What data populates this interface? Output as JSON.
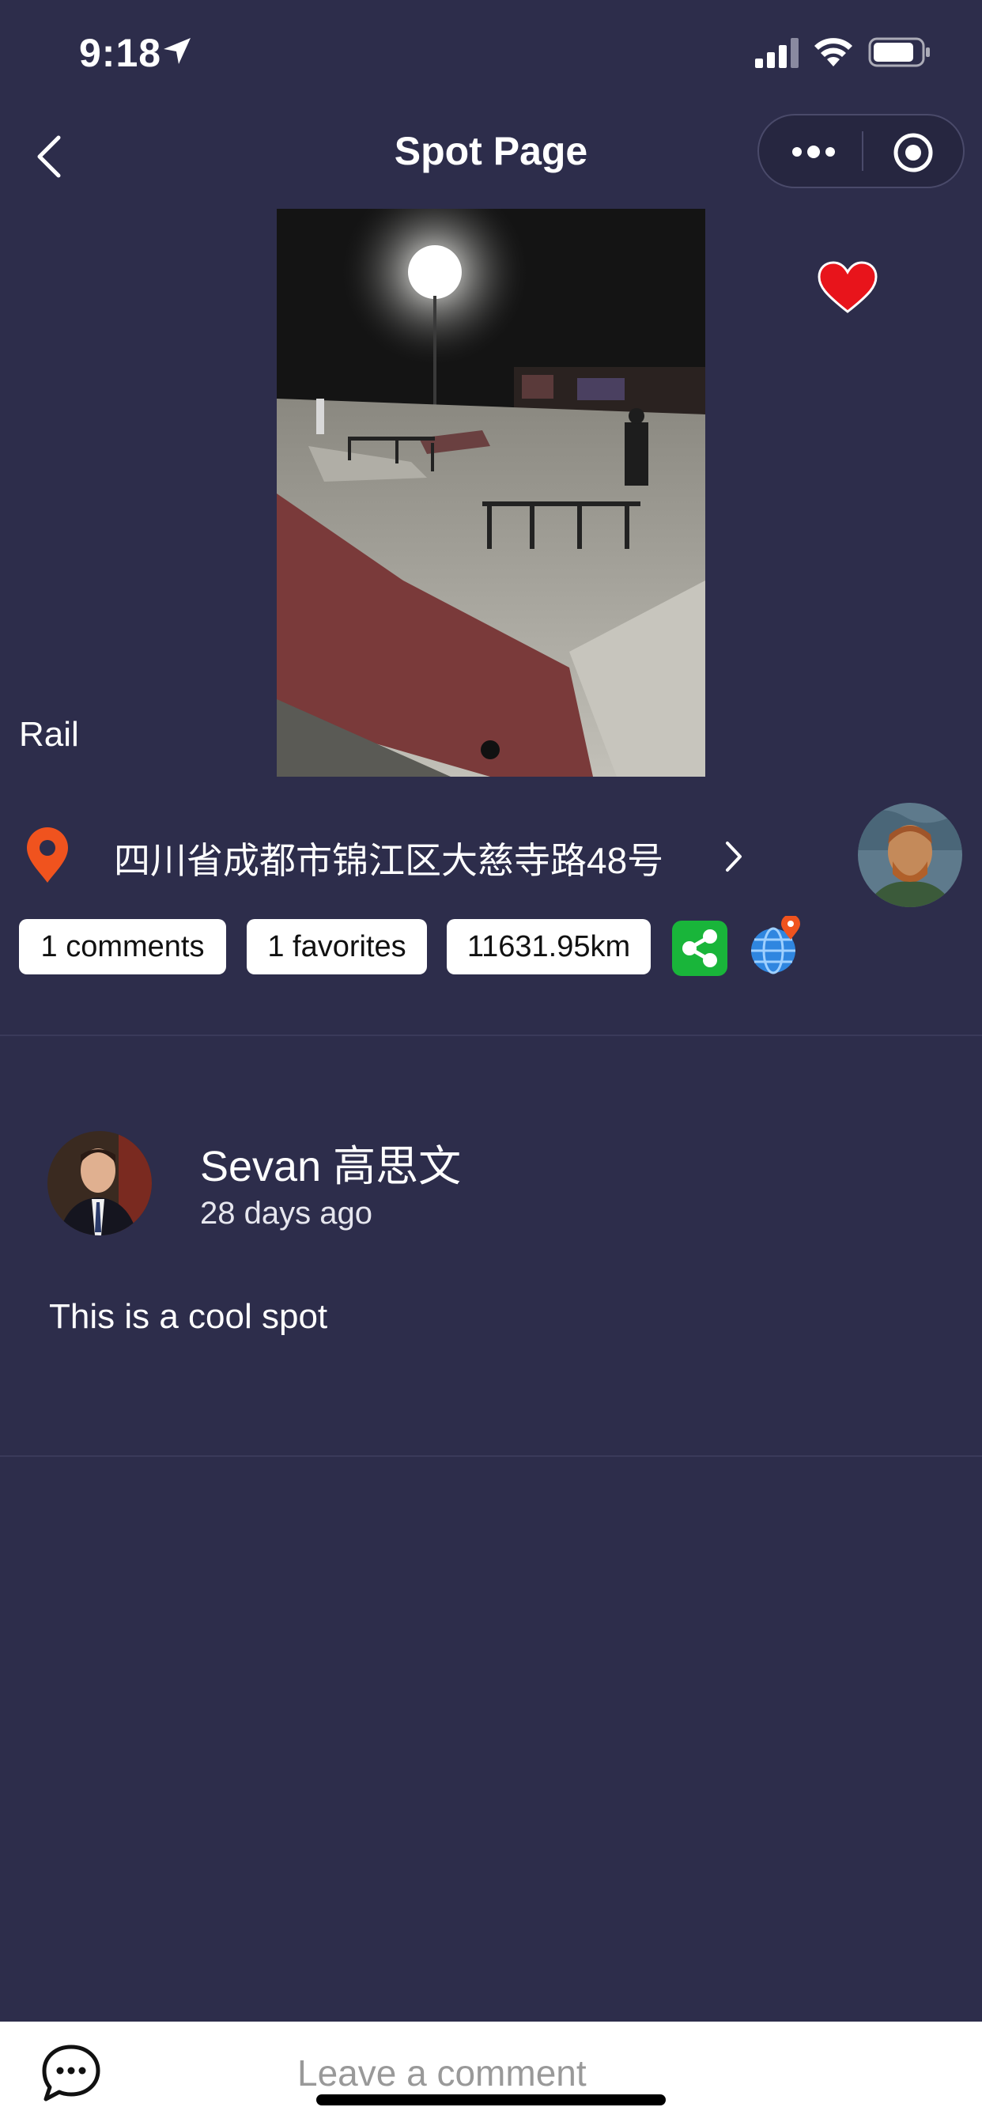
{
  "status_bar": {
    "time": "9:18"
  },
  "nav": {
    "title": "Spot Page"
  },
  "spot": {
    "type_label": "Rail",
    "address": "四川省成都市锦江区大慈寺路48号",
    "chips": {
      "comments": "1 comments",
      "favorites": "1 favorites",
      "distance": "11631.95km"
    }
  },
  "comment": {
    "author": "Sevan 高思文",
    "time": "28 days ago",
    "text": "This is a cool spot"
  },
  "bottom_bar": {
    "comment_placeholder": "Leave a comment"
  },
  "colors": {
    "background": "#2d2d4b",
    "heart": "#e8141b",
    "pin": "#f0531e",
    "share": "#19b53a"
  }
}
